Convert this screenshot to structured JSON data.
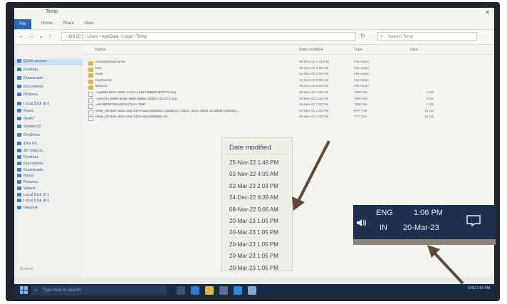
{
  "explorer": {
    "title": "Temp",
    "ribbon_tabs": [
      "File",
      "Home",
      "Share",
      "View"
    ],
    "address": "› OS (C:) › Users › AppData › Local › Temp",
    "search_placeholder": "Search Temp",
    "columns": [
      "Name",
      "Date modified",
      "Type",
      "Size"
    ],
    "nav_items": [
      "Quick access",
      "Desktop",
      "Downloads",
      "Documents",
      "Pictures",
      "Local Disk (D:)",
      "Music",
      "SHAIT",
      "System32",
      "OneDrive",
      "This PC",
      "3D Objects",
      "Desktop",
      "Documents",
      "Downloads",
      "Music",
      "Pictures",
      "Videos",
      "Local Disk (C:)",
      "Local Disk (D:)",
      "Network"
    ],
    "status": "11 items",
    "files": [
      {
        "name": "ActivityVisualCache",
        "date": "25-Nov-22 1:49 PM",
        "type": "File folder",
        "size": "",
        "kind": "folder"
      },
      {
        "name": "hsw",
        "date": "02-Nov-22 4:05 AM",
        "type": "File folder",
        "size": "",
        "kind": "folder"
      },
      {
        "name": "msdt",
        "date": "02-Mar-23 2:03 PM",
        "type": "File folder",
        "size": "",
        "kind": "folder"
      },
      {
        "name": "mscfcache",
        "date": "24-Dec-22 8:39 AM",
        "type": "File folder",
        "size": "",
        "kind": "folder"
      },
      {
        "name": "WinSAT",
        "date": "08-Nov-22 6:06 AM",
        "type": "File folder",
        "size": "",
        "kind": "folder"
      },
      {
        "name": "~vyb69A8071-2D81-41C4-A149-F58B0F3D0F70.tmp",
        "date": "20-Mar-23 1:05 PM",
        "type": "TMP File",
        "size": "1 KB",
        "kind": "doc"
      },
      {
        "name": "~vycD4A-B880-5E80-4B56-B8B6-7B2BCAD1473.tmp",
        "date": "20-Mar-23 1:05 PM",
        "type": "TMP File",
        "size": "0 KB",
        "kind": "doc"
      },
      {
        "name": "~DF4BFBFB9A2E0A2767A.TMP",
        "date": "20-Mar-23 1:05 PM",
        "type": "TMP File",
        "size": "1 KB",
        "kind": "doc"
      },
      {
        "name": "temp_E07fafc-a62e-4f3c-b07e-aba15f5538d (UNIMACT-1B4C-4847-A8DE-3A4B0B7A5D0D)...",
        "date": "20-Mar-23 1:05 PM",
        "type": "RPT File",
        "size": "16 KB",
        "kind": "doc"
      },
      {
        "name": "temp_E07fafc-a62e-4f3c-b07e-aba15f5538d.txt",
        "date": "20-Mar-23 1:05 PM",
        "type": "TXT File",
        "size": "18 KB",
        "kind": "doc"
      }
    ]
  },
  "taskbar": {
    "search_placeholder": "Type here to search",
    "tray_text": "ENG  1:06 PM"
  },
  "zoom_date_panel": {
    "title": "Date modified",
    "dates": [
      "25-Nov-22 1:49 PM",
      "02-Nov-22 4:05 AM",
      "02-Mar-23 2:03 PM",
      "24-Dec-22 8:39 AM",
      "08-Nov-22 6:06 AM",
      "20-Mar-23 1:05 PM",
      "20-Mar-23 1:05 PM",
      "20-Mar-23 1:05 PM",
      "20-Mar-23 1:05 PM",
      "20-Mar-23 1:05 PM"
    ]
  },
  "zoom_tray": {
    "lang_top": "ENG",
    "lang_bottom": "IN",
    "time": "1:06 PM",
    "date": "20-Mar-23"
  },
  "colors": {
    "taskbar": "#1a2a45",
    "accent": "#2b66b8",
    "arrow": "#5a4a3a"
  }
}
